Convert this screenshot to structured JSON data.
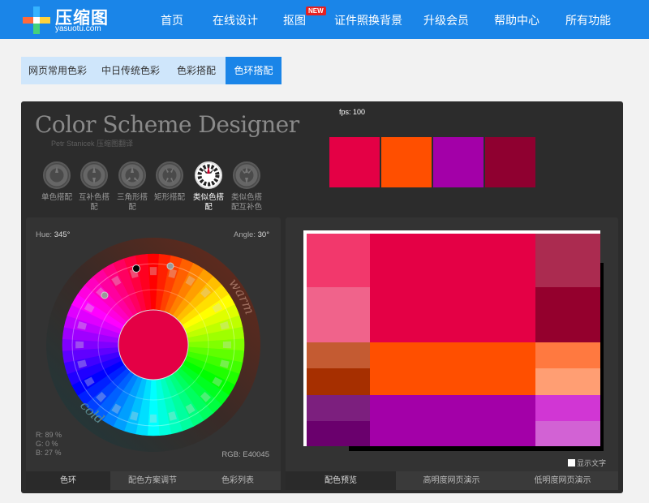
{
  "brand": {
    "name": "压缩图",
    "domain": "yasuotu.com"
  },
  "nav": {
    "items": [
      "首页",
      "在线设计",
      "抠图",
      "证件照换背景",
      "升级会员",
      "帮助中心",
      "所有功能"
    ],
    "badge": "NEW"
  },
  "tabs": [
    {
      "label": "网页常用色彩",
      "active": false
    },
    {
      "label": "中日传统色彩",
      "active": false
    },
    {
      "label": "色彩搭配",
      "active": false
    },
    {
      "label": "色环搭配",
      "active": true
    }
  ],
  "designer": {
    "title": "Color Scheme Designer",
    "author": "Petr Stanicek 压缩图翻译",
    "fps_label": "fps: 100",
    "scheme_colors": [
      "#e40045",
      "#ff4f00",
      "#a300a8",
      "#8f0030"
    ],
    "modes": [
      {
        "label": "单色搭配",
        "active": false
      },
      {
        "label": "互补色搭配",
        "active": false
      },
      {
        "label": "三角形搭配",
        "active": false
      },
      {
        "label": "矩形搭配",
        "active": false
      },
      {
        "label": "类似色搭配",
        "active": true
      },
      {
        "label": "类似色搭配互补色",
        "active": false
      }
    ],
    "wheel": {
      "hue_label": "Hue:",
      "hue_value": "345°",
      "angle_label": "Angle:",
      "angle_value": "30°",
      "warm_label": "warm",
      "cold_label": "cold",
      "r_line": "R: 89 %",
      "g_line": "G:   0 %",
      "b_line": "B: 27 %",
      "rgb_label": "RGB:",
      "rgb_value": "E40045",
      "center_color": "#e40045"
    },
    "left_tabs": [
      {
        "label": "色环",
        "active": true
      },
      {
        "label": "配色方案调节",
        "active": false
      },
      {
        "label": "色彩列表",
        "active": false
      }
    ],
    "right_tabs": [
      {
        "label": "配色预览",
        "active": true
      },
      {
        "label": "高明度网页演示",
        "active": false
      },
      {
        "label": "低明度网页演示",
        "active": false
      }
    ],
    "show_text_label": "显示文字",
    "preview_colors": {
      "primary_light1": "#f2386c",
      "primary_light2": "#f0638b",
      "primary_main": "#e40045",
      "primary_dark1": "#ab2b50",
      "primary_dark2": "#94002d",
      "comp1_main": "#ff4f00",
      "comp1_a": "#c45b32",
      "comp1_b": "#a62f00",
      "comp1_light1": "#ff7940",
      "comp1_light2": "#ff9e73",
      "comp2_main": "#a300a8",
      "comp2_a": "#7c1f7e",
      "comp2_b": "#6a006d",
      "comp2_light1": "#d136d4",
      "comp2_light2": "#d262d4"
    }
  }
}
